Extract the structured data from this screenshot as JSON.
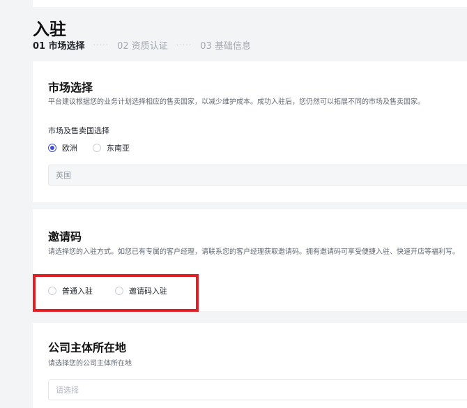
{
  "page": {
    "title": "入驻",
    "steps": [
      {
        "label": "01 市场选择",
        "state": "active"
      },
      {
        "label": "02 资质认证",
        "state": "inactive"
      },
      {
        "label": "03 基础信息",
        "state": "inactive"
      }
    ],
    "step_separator": "·····"
  },
  "market_section": {
    "title": "市场选择",
    "description": "平台建议根据您的业务计划选择相应的售卖国家，以减少维护成本。成功入驻后，您仍然可以拓展不同的市场及售卖国家。",
    "field_label": "市场及售卖国选择",
    "options": [
      {
        "label": "欧洲",
        "checked": true
      },
      {
        "label": "东南亚",
        "checked": false
      }
    ],
    "country_value": "英国"
  },
  "invite_section": {
    "title": "邀请码",
    "description": "请选择您的入驻方式。如您已有专属的客户经理，请联系您的客户经理获取邀请码。拥有邀请码可享受便捷入驻、快速开店等福利写。",
    "options": [
      {
        "label": "普通入驻",
        "checked": false
      },
      {
        "label": "邀请码入驻",
        "checked": false
      }
    ]
  },
  "company_section": {
    "title": "公司主体所在地",
    "description": "请选择您的公司主体所在地",
    "placeholder": "请选择"
  },
  "colors": {
    "accent": "#3f4fd1",
    "highlight_border": "#e01f25",
    "background": "#f3f4f6"
  }
}
